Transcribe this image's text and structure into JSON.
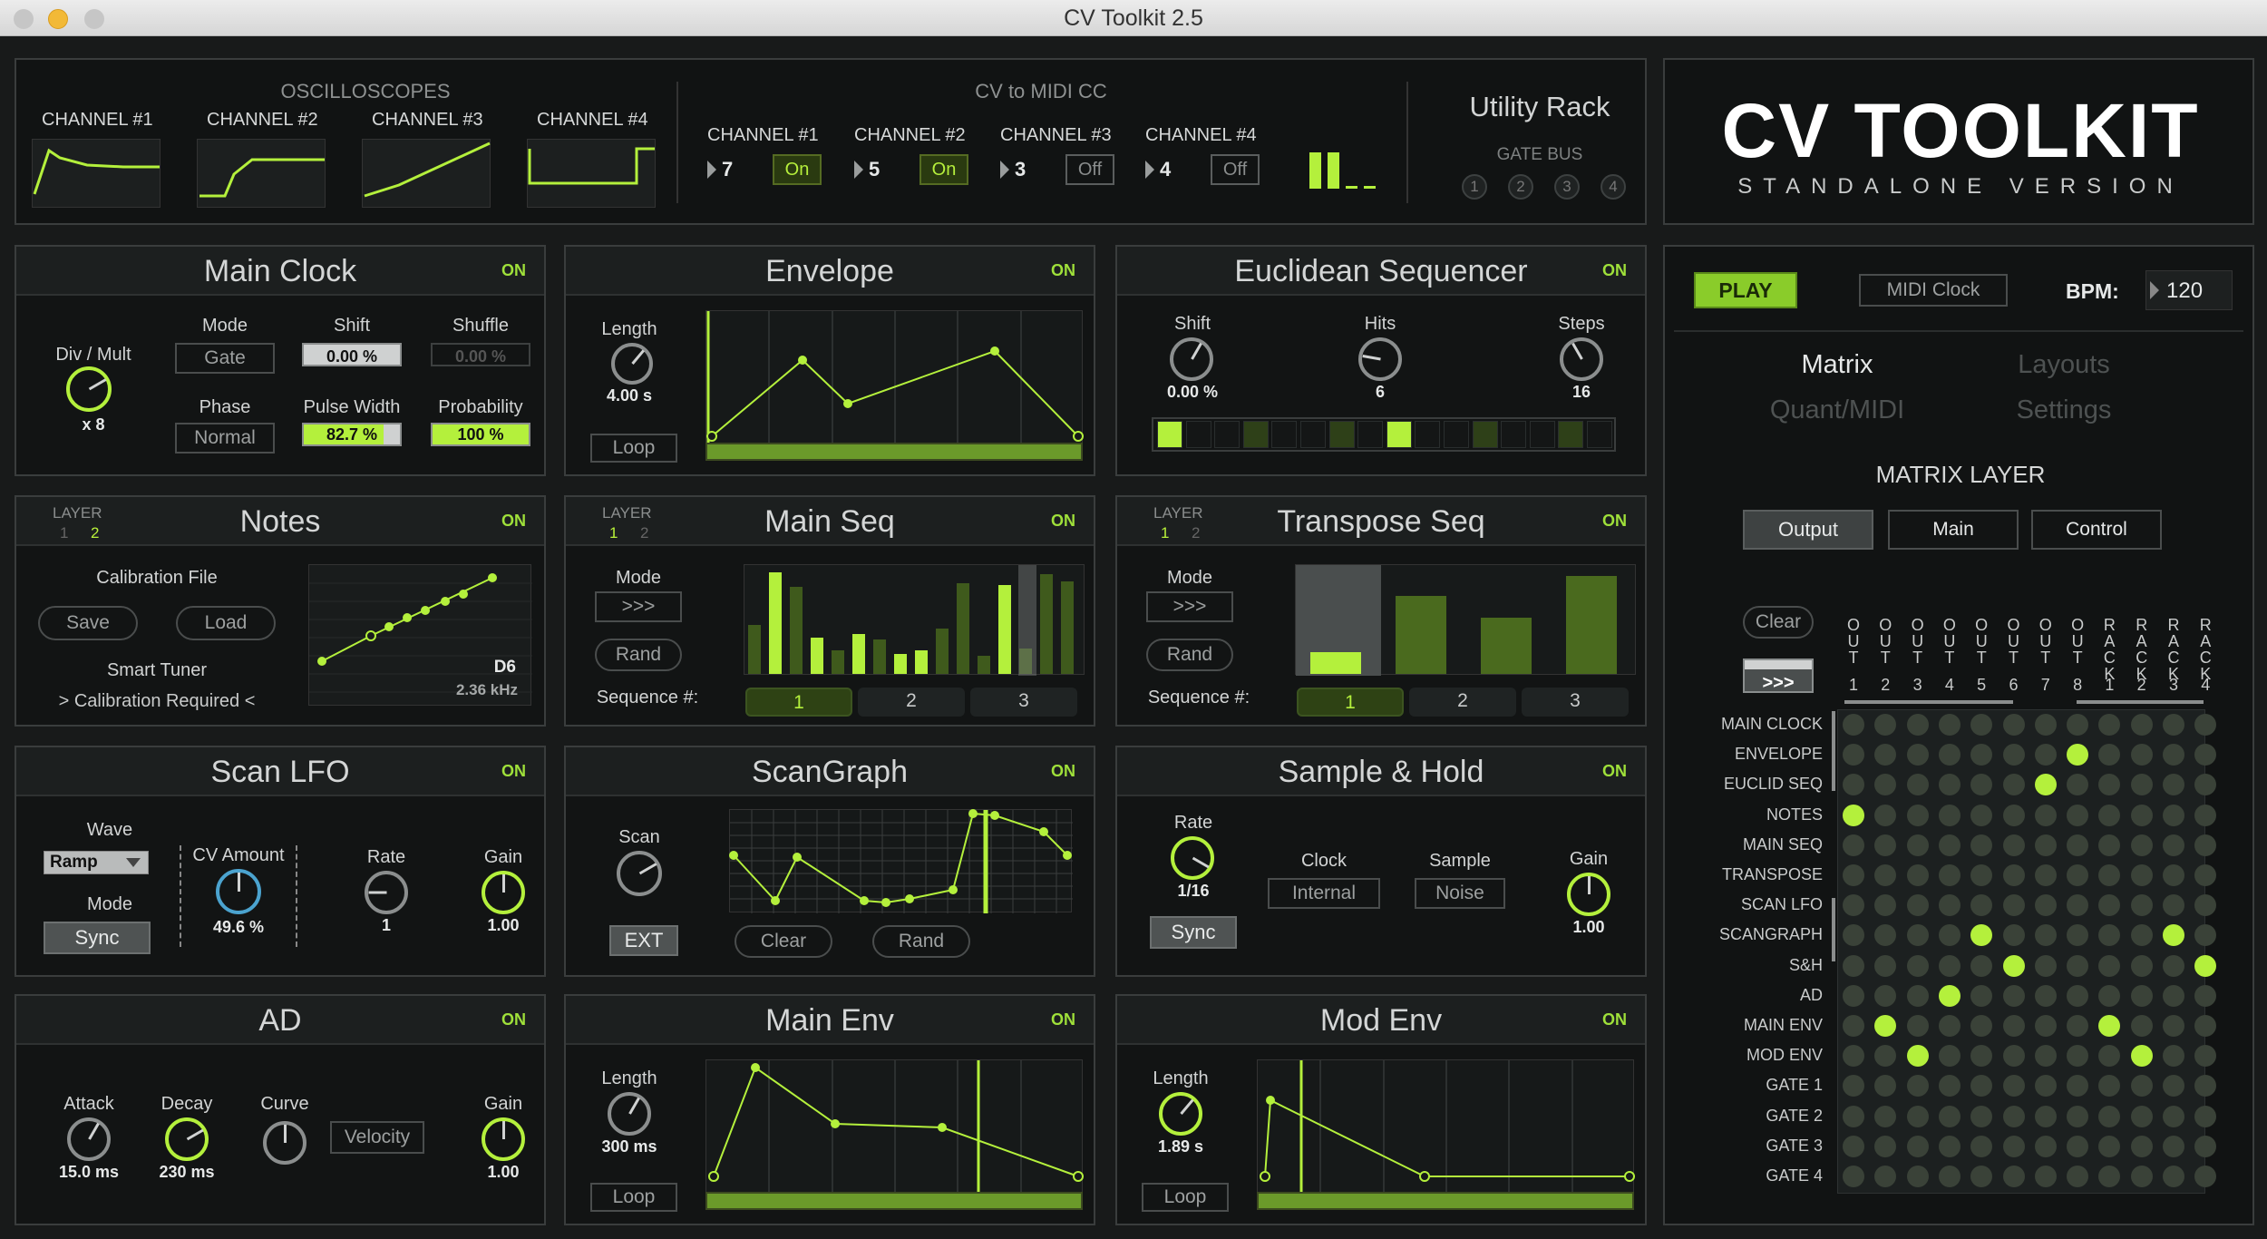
{
  "window": {
    "title": "CV Toolkit 2.5"
  },
  "osc": {
    "title": "OSCILLOSCOPES",
    "channels": [
      "CHANNEL #1",
      "CHANNEL #2",
      "CHANNEL #3",
      "CHANNEL #4"
    ]
  },
  "midi": {
    "title": "CV to MIDI CC",
    "channels": [
      {
        "label": "CHANNEL #1",
        "num": "7",
        "state": "On"
      },
      {
        "label": "CHANNEL #2",
        "num": "5",
        "state": "On"
      },
      {
        "label": "CHANNEL #3",
        "num": "3",
        "state": "Off"
      },
      {
        "label": "CHANNEL #4",
        "num": "4",
        "state": "Off"
      }
    ]
  },
  "utility": {
    "title": "Utility Rack",
    "gate_bus": "GATE BUS",
    "gates": [
      "1",
      "2",
      "3",
      "4"
    ]
  },
  "logo": {
    "title": "CV TOOLKIT",
    "subtitle": "STANDALONE VERSION"
  },
  "on": "ON",
  "layer": {
    "label": "LAYER",
    "one": "1",
    "two": "2"
  },
  "main_clock": {
    "title": "Main Clock",
    "div_mult": "Div / Mult",
    "div_val": "x 8",
    "mode": "Mode",
    "mode_val": "Gate",
    "shift": "Shift",
    "shift_val": "0.00 %",
    "shuffle": "Shuffle",
    "shuffle_val": "0.00 %",
    "phase": "Phase",
    "phase_val": "Normal",
    "pw": "Pulse Width",
    "pw_val": "82.7 %",
    "pw_level": 0.827,
    "prob": "Probability",
    "prob_val": "100 %",
    "prob_level": 1.0
  },
  "envelope": {
    "title": "Envelope",
    "length": "Length",
    "length_val": "4.00 s",
    "loop": "Loop"
  },
  "euclid": {
    "title": "Euclidean Sequencer",
    "shift": "Shift",
    "shift_val": "0.00 %",
    "hits": "Hits",
    "hits_val": "6",
    "steps": "Steps",
    "steps_val": "16"
  },
  "notes": {
    "title": "Notes",
    "cal_file": "Calibration File",
    "save": "Save",
    "load": "Load",
    "smart_tuner": "Smart Tuner",
    "cal_req": "> Calibration Required <",
    "note": "D6",
    "freq": "2.36 kHz"
  },
  "main_seq": {
    "title": "Main Seq",
    "mode": "Mode",
    "mode_val": ">>>",
    "rand": "Rand",
    "seq_label": "Sequence #:",
    "seqs": [
      "1",
      "2",
      "3"
    ]
  },
  "transpose_seq": {
    "title": "Transpose Seq",
    "mode": "Mode",
    "mode_val": ">>>",
    "rand": "Rand",
    "seq_label": "Sequence #:",
    "seqs": [
      "1",
      "2",
      "3"
    ]
  },
  "scan_lfo": {
    "title": "Scan LFO",
    "wave": "Wave",
    "wave_val": "Ramp",
    "mode": "Mode",
    "mode_val": "Sync",
    "cv_amount": "CV Amount",
    "cv_val": "49.6 %",
    "rate": "Rate",
    "rate_val": "1",
    "gain": "Gain",
    "gain_val": "1.00"
  },
  "scangraph": {
    "title": "ScanGraph",
    "scan": "Scan",
    "ext": "EXT",
    "clear": "Clear",
    "rand": "Rand"
  },
  "sample_hold": {
    "title": "Sample & Hold",
    "rate": "Rate",
    "rate_val": "1/16",
    "sync": "Sync",
    "clock": "Clock",
    "clock_val": "Internal",
    "sample": "Sample",
    "sample_val": "Noise",
    "gain": "Gain",
    "gain_val": "1.00"
  },
  "ad": {
    "title": "AD",
    "attack": "Attack",
    "attack_val": "15.0 ms",
    "decay": "Decay",
    "decay_val": "230 ms",
    "curve": "Curve",
    "velocity": "Velocity",
    "gain": "Gain",
    "gain_val": "1.00"
  },
  "main_env": {
    "title": "Main Env",
    "length": "Length",
    "length_val": "300 ms",
    "loop": "Loop"
  },
  "mod_env": {
    "title": "Mod Env",
    "length": "Length",
    "length_val": "1.89 s",
    "loop": "Loop"
  },
  "transport": {
    "play": "PLAY",
    "midi_clock": "MIDI Clock",
    "bpm_label": "BPM:",
    "bpm": "120"
  },
  "tabs": {
    "matrix": "Matrix",
    "layouts": "Layouts",
    "quant": "Quant/MIDI",
    "settings": "Settings"
  },
  "matrix": {
    "title": "MATRIX LAYER",
    "output": "Output",
    "main": "Main",
    "control": "Control",
    "clear": "Clear",
    "arrows": ">>>",
    "cols": [
      {
        "t": "OUT",
        "n": "1"
      },
      {
        "t": "OUT",
        "n": "2"
      },
      {
        "t": "OUT",
        "n": "3"
      },
      {
        "t": "OUT",
        "n": "4"
      },
      {
        "t": "OUT",
        "n": "5"
      },
      {
        "t": "OUT",
        "n": "6"
      },
      {
        "t": "OUT",
        "n": "7"
      },
      {
        "t": "OUT",
        "n": "8"
      },
      {
        "t": "RACK",
        "n": "1"
      },
      {
        "t": "RACK",
        "n": "2"
      },
      {
        "t": "RACK",
        "n": "3"
      },
      {
        "t": "RACK",
        "n": "4"
      }
    ],
    "rows": [
      "MAIN CLOCK",
      "ENVELOPE",
      "EUCLID SEQ",
      "NOTES",
      "MAIN SEQ",
      "TRANSPOSE",
      "SCAN LFO",
      "SCANGRAPH",
      "S&H",
      "AD",
      "MAIN ENV",
      "MOD ENV",
      "GATE 1",
      "GATE 2",
      "GATE 3",
      "GATE 4"
    ],
    "active": [
      [
        1,
        7
      ],
      [
        2,
        6
      ],
      [
        3,
        0
      ],
      [
        7,
        4
      ],
      [
        7,
        10
      ],
      [
        8,
        5
      ],
      [
        8,
        11
      ],
      [
        9,
        3
      ],
      [
        10,
        1
      ],
      [
        10,
        8
      ],
      [
        11,
        2
      ],
      [
        11,
        9
      ]
    ]
  },
  "colors": {
    "accent": "#b4f03c",
    "panel": "#121414",
    "border": "#3a3d3d"
  }
}
